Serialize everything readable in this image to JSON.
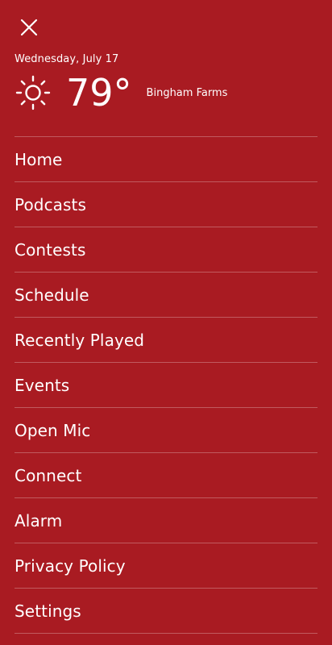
{
  "header": {
    "close_icon": "close-icon"
  },
  "weather": {
    "date": "Wednesday, July 17",
    "icon": "sun-icon",
    "temperature": "79°",
    "location": "Bingham Farms"
  },
  "menu": {
    "items": [
      {
        "label": "Home"
      },
      {
        "label": "Podcasts"
      },
      {
        "label": "Contests"
      },
      {
        "label": "Schedule"
      },
      {
        "label": "Recently Played"
      },
      {
        "label": "Events"
      },
      {
        "label": "Open Mic"
      },
      {
        "label": "Connect"
      },
      {
        "label": "Alarm"
      },
      {
        "label": "Privacy Policy"
      },
      {
        "label": "Settings"
      }
    ]
  },
  "colors": {
    "background": "#a91b22",
    "text": "#ffffff"
  }
}
